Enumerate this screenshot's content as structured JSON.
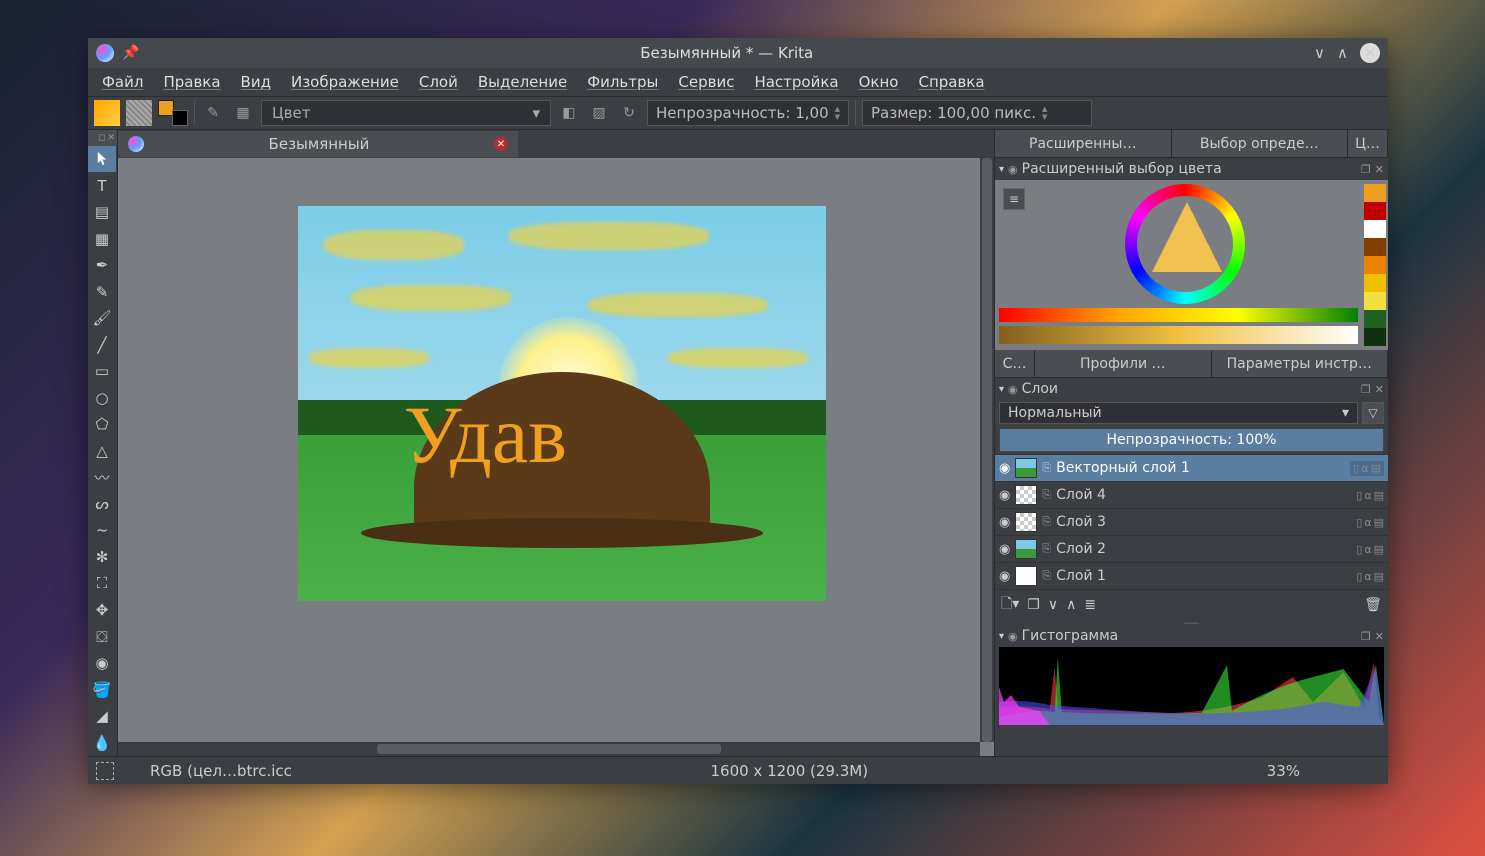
{
  "titlebar": {
    "title": "Безымянный * — Krita"
  },
  "menu": {
    "items": [
      "Файл",
      "Правка",
      "Вид",
      "Изображение",
      "Слой",
      "Выделение",
      "Фильтры",
      "Сервис",
      "Настройка",
      "Окно",
      "Справка"
    ]
  },
  "toolbar": {
    "blend_mode": "Цвет",
    "opacity_label": "Непрозрачность:",
    "opacity_value": "1,00",
    "size_label": "Размер:",
    "size_value": "100,00 пикс."
  },
  "document_tab": {
    "title": "Безымянный"
  },
  "canvas_text": "Удав",
  "docker_tabs_top": [
    "Расширенны…",
    "Выбор опреде…",
    "Ц…"
  ],
  "color_selector_title": "Расширенный выбор цвета",
  "swatch_colors": [
    "#f0a020",
    "#c00000",
    "#fff",
    "#804000",
    "#f08000",
    "#f0c000",
    "#f0e040",
    "#206020",
    "#103010"
  ],
  "docker_tabs_mid": [
    "С…",
    "Профили …",
    "Параметры инстр…"
  ],
  "layers": {
    "title": "Слои",
    "mode": "Нормальный",
    "opacity": "Непрозрачность:  100%",
    "list": [
      {
        "name": "Векторный слой 1",
        "selected": true,
        "thumb": "img"
      },
      {
        "name": "Слой 4",
        "selected": false,
        "thumb": "trans"
      },
      {
        "name": "Слой 3",
        "selected": false,
        "thumb": "trans"
      },
      {
        "name": "Слой 2",
        "selected": false,
        "thumb": "img"
      },
      {
        "name": "Слой 1",
        "selected": false,
        "thumb": "white"
      }
    ]
  },
  "histogram_title": "Гистограмма",
  "statusbar": {
    "color_profile": "RGB (цел…btrc.icc",
    "dimensions": "1600 x 1200 (29.3M)",
    "zoom": "33%"
  }
}
